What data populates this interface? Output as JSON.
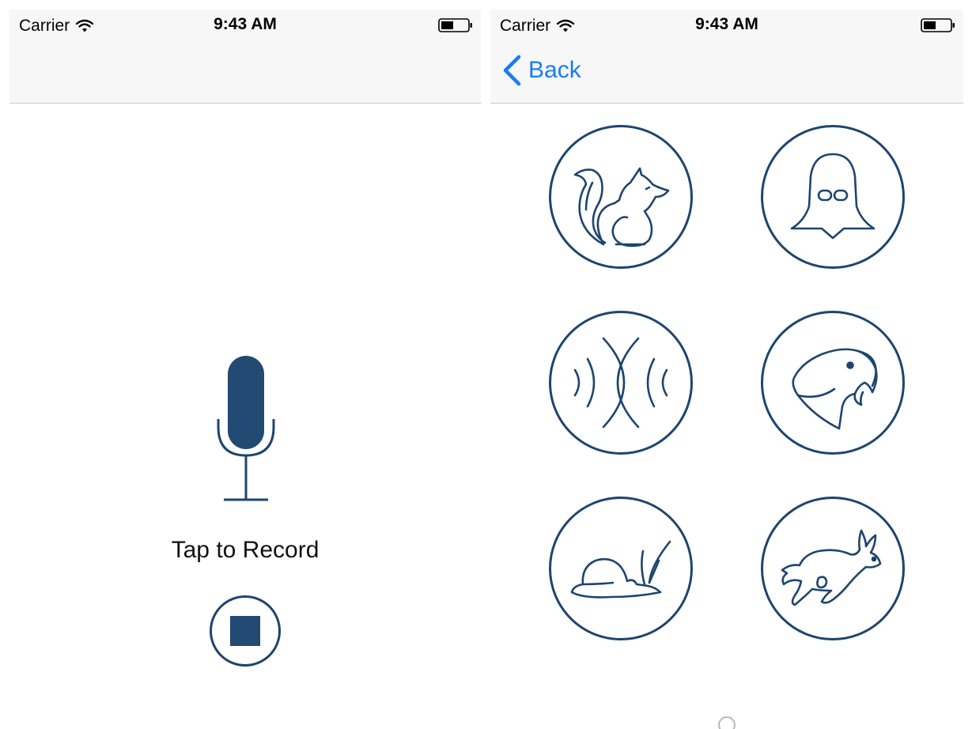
{
  "left_screen": {
    "status_bar": {
      "carrier": "Carrier",
      "time": "9:43 AM"
    },
    "recording": {
      "label": "Tap to Record"
    },
    "icons": {
      "microphone": "microphone-icon",
      "stop": "stop-icon"
    }
  },
  "right_screen": {
    "status_bar": {
      "carrier": "Carrier",
      "time": "9:43 AM"
    },
    "navbar": {
      "back_label": "Back"
    },
    "effects": [
      {
        "icon": "chipmunk-icon"
      },
      {
        "icon": "darth-vader-icon"
      },
      {
        "icon": "echo-icon"
      },
      {
        "icon": "parrot-icon"
      },
      {
        "icon": "snail-icon"
      },
      {
        "icon": "rabbit-icon"
      }
    ]
  },
  "colors": {
    "accent": "#1a7cf5",
    "icon_stroke": "#1e456e",
    "icon_fill": "#224a72",
    "navbar_bg": "#f7f7f7",
    "divider": "#c8c8cc"
  }
}
